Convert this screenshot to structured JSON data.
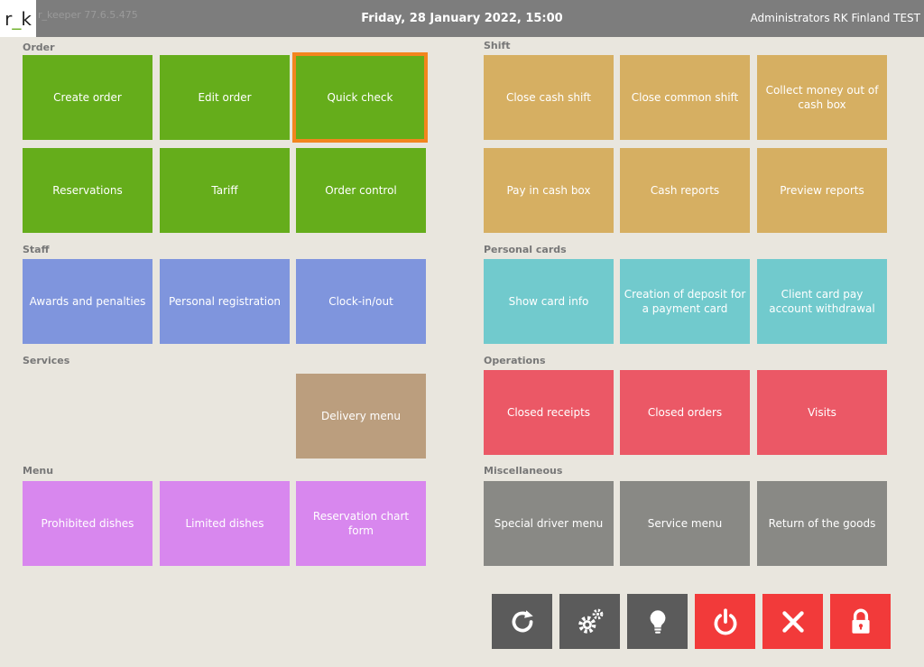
{
  "header": {
    "logo_left": "r",
    "logo_mid": "_",
    "logo_right": "k",
    "version": "r_keeper 77.6.5.475",
    "datetime": "Friday, 28 January 2022, 15:00",
    "user": "Administrators RK Finland TEST"
  },
  "sections": {
    "order": "Order",
    "shift": "Shift",
    "staff": "Staff",
    "personal_cards": "Personal cards",
    "services": "Services",
    "operations": "Operations",
    "menu": "Menu",
    "misc": "Miscellaneous"
  },
  "order": {
    "create": "Create order",
    "edit": "Edit order",
    "quick_check": "Quick check",
    "reservations": "Reservations",
    "tariff": "Tariff",
    "control": "Order control"
  },
  "shift": {
    "close_cash": "Close cash shift",
    "close_common": "Close common shift",
    "collect_money": "Collect money out of cash box",
    "pay_in": "Pay in cash box",
    "cash_reports": "Cash reports",
    "preview_reports": "Preview reports"
  },
  "staff": {
    "awards": "Awards and penalties",
    "personal_registration": "Personal registration",
    "clock": "Clock-in/out"
  },
  "cards": {
    "show_info": "Show card info",
    "deposit": "Creation of deposit for a payment card",
    "withdrawal": "Client card pay account withdrawal"
  },
  "services": {
    "delivery": "Delivery menu"
  },
  "operations": {
    "closed_receipts": "Closed receipts",
    "closed_orders": "Closed orders",
    "visits": "Visits"
  },
  "menu": {
    "prohibited": "Prohibited dishes",
    "limited": "Limited dishes",
    "reservation_chart": "Reservation chart form"
  },
  "misc": {
    "driver": "Special driver menu",
    "service": "Service menu",
    "return": "Return of the goods"
  },
  "toolbar": {
    "refresh": "refresh-icon",
    "settings": "gears-icon",
    "hint": "lightbulb-icon",
    "power": "power-icon",
    "close": "close-icon",
    "lock": "lock-icon"
  },
  "colors": {
    "green": "#65ad1b",
    "orange": "#d6af62",
    "blue": "#7f95dd",
    "teal": "#71cacd",
    "red": "#eb5866",
    "brown": "#bb9e7e",
    "purple": "#d887ee",
    "gray": "#898985",
    "highlight": "#f3851e"
  }
}
